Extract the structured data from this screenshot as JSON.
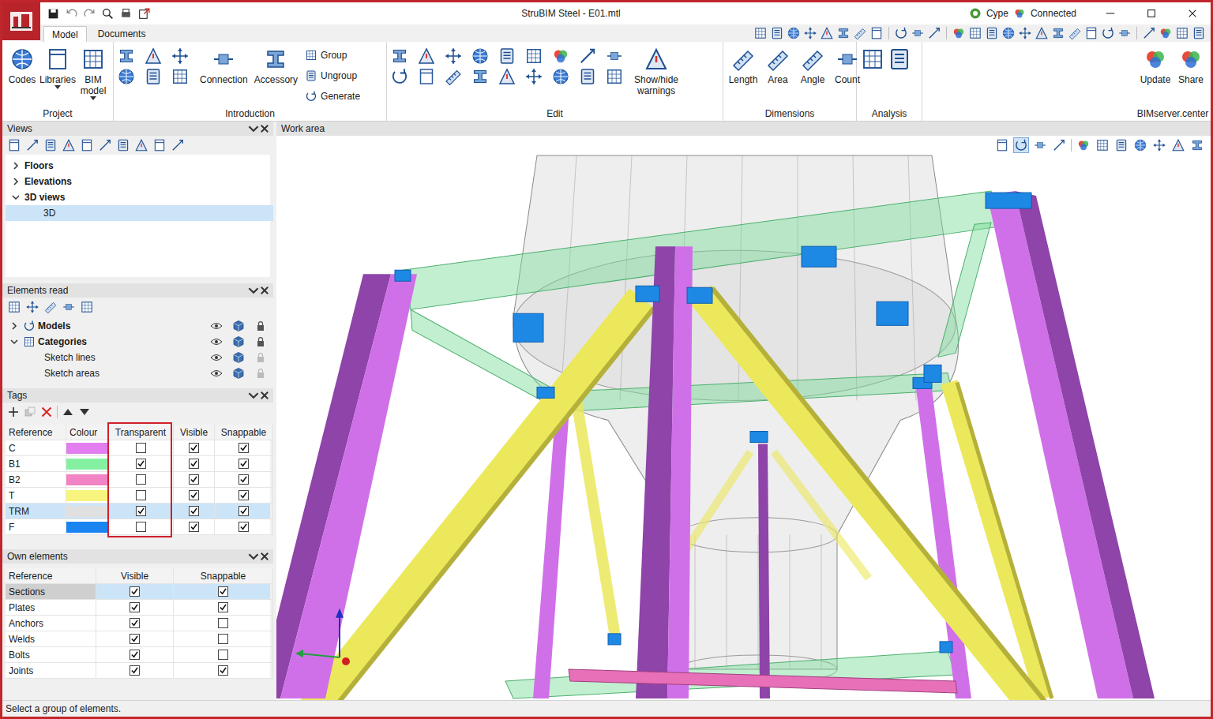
{
  "window": {
    "title": "StruBIM Steel - E01.mtl",
    "account": "Cype",
    "connection": "Connected"
  },
  "ribbon": {
    "tabs": [
      {
        "label": "Model",
        "selected": true
      },
      {
        "label": "Documents",
        "selected": false
      }
    ],
    "groups": [
      {
        "name": "Project",
        "large": [
          {
            "label": "Codes",
            "dropdown": false
          },
          {
            "label": "Libraries",
            "dropdown": true
          },
          {
            "label": "BIM model",
            "dropdown": true
          }
        ],
        "small": []
      },
      {
        "name": "Introduction",
        "large": [
          {
            "label": "Connection",
            "dropdown": false
          },
          {
            "label": "Accessory",
            "dropdown": false
          }
        ],
        "small": [
          {
            "label": "Group"
          },
          {
            "label": "Ungroup"
          },
          {
            "label": "Generate"
          }
        ]
      },
      {
        "name": "Edit",
        "large": [
          {
            "label": "Show/hide warnings",
            "dropdown": false
          }
        ],
        "small": []
      },
      {
        "name": "Dimensions",
        "large": [
          {
            "label": "Length",
            "dropdown": false
          },
          {
            "label": "Area",
            "dropdown": false
          },
          {
            "label": "Angle",
            "dropdown": false
          },
          {
            "label": "Count",
            "dropdown": false
          }
        ],
        "small": []
      },
      {
        "name": "Analysis",
        "large": [],
        "small": []
      },
      {
        "name": "BIMserver.center",
        "large": [
          {
            "label": "Update",
            "dropdown": false
          },
          {
            "label": "Share",
            "dropdown": false
          }
        ],
        "small": []
      }
    ]
  },
  "views": {
    "title": "Views",
    "tree": [
      {
        "label": "Floors",
        "depth": 0,
        "expanded": false,
        "selected": false
      },
      {
        "label": "Elevations",
        "depth": 0,
        "expanded": false,
        "selected": false
      },
      {
        "label": "3D views",
        "depth": 0,
        "expanded": true,
        "selected": false
      },
      {
        "label": "3D",
        "depth": 1,
        "selected": true
      }
    ]
  },
  "elements_read": {
    "title": "Elements read",
    "tree": [
      {
        "label": "Models",
        "depth": 0,
        "expanded": false,
        "locked": true
      },
      {
        "label": "Categories",
        "depth": 0,
        "expanded": true,
        "locked": true
      },
      {
        "label": "Sketch lines",
        "depth": 1,
        "locked": false
      },
      {
        "label": "Sketch areas",
        "depth": 1,
        "locked": false
      }
    ]
  },
  "tags": {
    "title": "Tags",
    "columns": [
      {
        "label": "Reference",
        "highlighted": false
      },
      {
        "label": "Colour",
        "highlighted": false
      },
      {
        "label": "Transparent",
        "highlighted": true
      },
      {
        "label": "Visible",
        "highlighted": false
      },
      {
        "label": "Snappable",
        "highlighted": false
      }
    ],
    "rows": [
      {
        "reference": "C",
        "color": "#e27ef0",
        "transparent": false,
        "visible": true,
        "snappable": true,
        "selected": false
      },
      {
        "reference": "B1",
        "color": "#85f0a2",
        "transparent": true,
        "visible": true,
        "snappable": true,
        "selected": false
      },
      {
        "reference": "B2",
        "color": "#f283c4",
        "transparent": false,
        "visible": true,
        "snappable": true,
        "selected": false
      },
      {
        "reference": "T",
        "color": "#f7f57e",
        "transparent": false,
        "visible": true,
        "snappable": true,
        "selected": false
      },
      {
        "reference": "TRM",
        "color": "#e0e0e0",
        "transparent": true,
        "visible": true,
        "snappable": true,
        "selected": true
      },
      {
        "reference": "F",
        "color": "#1a84f0",
        "transparent": false,
        "visible": true,
        "snappable": true,
        "selected": false
      }
    ]
  },
  "own_elements": {
    "title": "Own elements",
    "columns": [
      {
        "label": "Reference"
      },
      {
        "label": "Visible"
      },
      {
        "label": "Snappable"
      }
    ],
    "rows": [
      {
        "reference": "Sections",
        "visible": true,
        "snappable": true,
        "selected": true
      },
      {
        "reference": "Plates",
        "visible": true,
        "snappable": true,
        "selected": false
      },
      {
        "reference": "Anchors",
        "visible": true,
        "snappable": false,
        "selected": false
      },
      {
        "reference": "Welds",
        "visible": true,
        "snappable": false,
        "selected": false
      },
      {
        "reference": "Bolts",
        "visible": true,
        "snappable": false,
        "selected": false
      },
      {
        "reference": "Joints",
        "visible": true,
        "snappable": true,
        "selected": false
      }
    ]
  },
  "work_area": {
    "title": "Work area"
  },
  "status_bar": "Select a group of elements."
}
